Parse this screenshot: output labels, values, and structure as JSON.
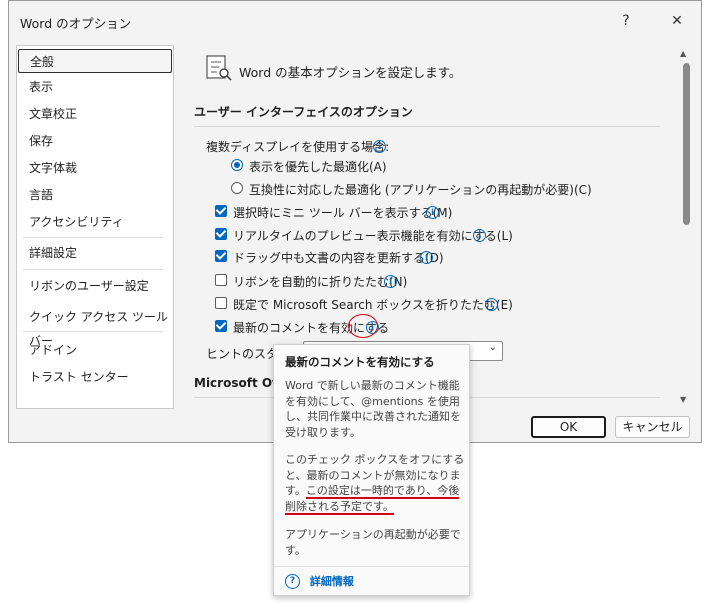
{
  "window": {
    "title": "Word のオプション",
    "help": "?",
    "close": "✕"
  },
  "nav": {
    "items": [
      "全般",
      "表示",
      "文章校正",
      "保存",
      "文字体裁",
      "言語",
      "アクセシビリティ",
      "詳細設定",
      "リボンのユーザー設定",
      "クイック アクセス ツール バー",
      "アドイン",
      "トラスト センター"
    ],
    "selected": "全般"
  },
  "header": {
    "text": "Word の基本オプションを設定します。"
  },
  "section": {
    "ui_options": "ユーザー インターフェイスのオプション",
    "microsoft": "Microsoft Of"
  },
  "multi_display": {
    "label": "複数ディスプレイを使用する場合:",
    "option1": "表示を優先した最適化(A)",
    "option2": "互換性に対応した最適化 (アプリケーションの再起動が必要)(C)",
    "selected": "option1"
  },
  "checks": [
    {
      "label": "選択時にミニ ツール バーを表示する(M)",
      "checked": true
    },
    {
      "label": "リアルタイムのプレビュー表示機能を有効にする(L)",
      "checked": true
    },
    {
      "label": "ドラッグ中も文書の内容を更新する(D)",
      "checked": true
    },
    {
      "label": "リボンを自動的に折りたたむ(N)",
      "checked": false
    },
    {
      "label": "既定で Microsoft Search ボックスを折りたたむ(E)",
      "checked": false
    },
    {
      "label": "最新のコメントを有効にする",
      "checked": true
    }
  ],
  "hint_style": {
    "label": "ヒントのスタイル"
  },
  "buttons": {
    "ok": "OK",
    "cancel": "キャンセル"
  },
  "tooltip": {
    "title": "最新のコメントを有効にする",
    "para1": "Word で新しい最新のコメント機能を有効にして、@mentions を使用し、共同作業中に改善された通知を受け取ります。",
    "para2_a": "このチェック ボックスをオフにすると、最新のコメントが無効になります。",
    "para2_b": "この設定は一時的であり、今後削除される予定です。",
    "para3": "アプリケーションの再起動が必要です。",
    "link": "詳細情報"
  },
  "colors": {
    "accent": "#0067c0",
    "annotation": "#d0021b"
  }
}
